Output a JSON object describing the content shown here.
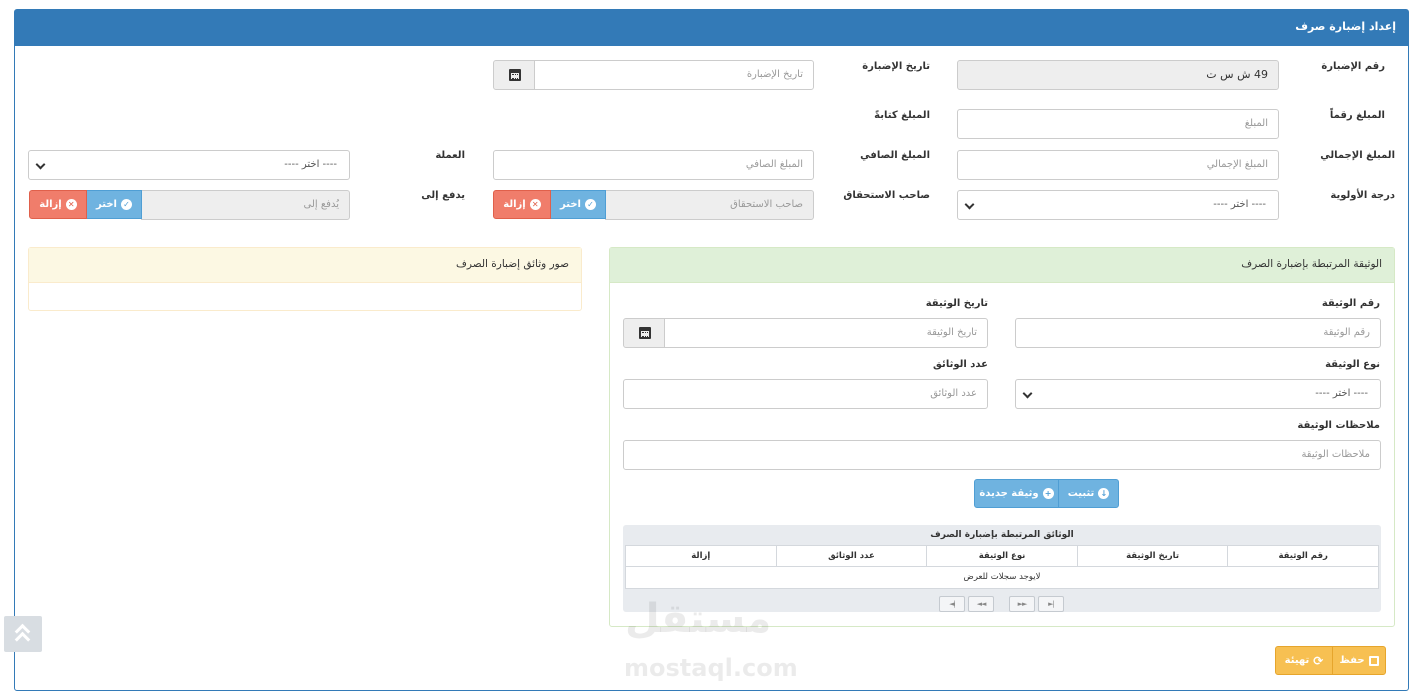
{
  "header": {
    "title": "إعداد إضبارة صرف"
  },
  "form": {
    "number_label": "رقم الإضبارة",
    "number_value": "49 ش س ت",
    "date_label": "تاريخ الإضبارة",
    "date_placeholder": "تاريخ الإضبارة",
    "amount_num_label": "المبلغ رقماً",
    "amount_num_placeholder": "المبلغ",
    "amount_text_label": "المبلغ كتابةً",
    "total_label": "المبلغ الإجمالي",
    "total_placeholder": "المبلغ الإجمالي",
    "net_label": "المبلغ الصافي",
    "net_placeholder": "المبلغ الصافي",
    "currency_label": "العملة",
    "currency_value": "---- اختر ----",
    "priority_label": "درجة الأولوية",
    "priority_value": "---- اختر ----",
    "beneficiary_label": "صاحب الاستحقاق",
    "beneficiary_placeholder": "صاحب الاستحقاق",
    "payto_label": "يدفع إلى",
    "payto_placeholder": "يُدفع إلى",
    "choose_label": "اختر",
    "remove_label": "إزالة"
  },
  "doc_panel": {
    "title": "الوثيقة المرتبطة بإضبارة الصرف",
    "doc_number_label": "رقم الوثيقة",
    "doc_number_placeholder": "رقم الوثيقة",
    "doc_date_label": "تاريخ الوثيقة",
    "doc_date_placeholder": "تاريخ الوثيقة",
    "doc_type_label": "نوع الوثيقة",
    "doc_type_value": "---- اختر ----",
    "doc_count_label": "عدد الوثائق",
    "doc_count_placeholder": "عدد الوثائق",
    "doc_notes_label": "ملاحظات الوثيقة",
    "doc_notes_placeholder": "ملاحظات الوثيقة",
    "save_doc_label": "تثبيت",
    "new_doc_label": "وثيقة جديدة"
  },
  "table": {
    "caption": "الوثائق المرتبطة بإضبارة الصرف",
    "columns": [
      "رقم الوثيقة",
      "تاريخ الوثيقة",
      "نوع الوثيقة",
      "عدد الوثائق",
      "إزالة"
    ],
    "empty": "لايوجد سجلات للعرض",
    "pager": [
      "◄|",
      "◄◄",
      "►►",
      "►|"
    ]
  },
  "images_panel": {
    "title": "صور وثائق إضبارة الصرف"
  },
  "footer": {
    "save_label": "حفظ",
    "reset_label": "تهيئة"
  },
  "watermark": {
    "arabic": "مستقل",
    "latin": "mostaql.com"
  }
}
